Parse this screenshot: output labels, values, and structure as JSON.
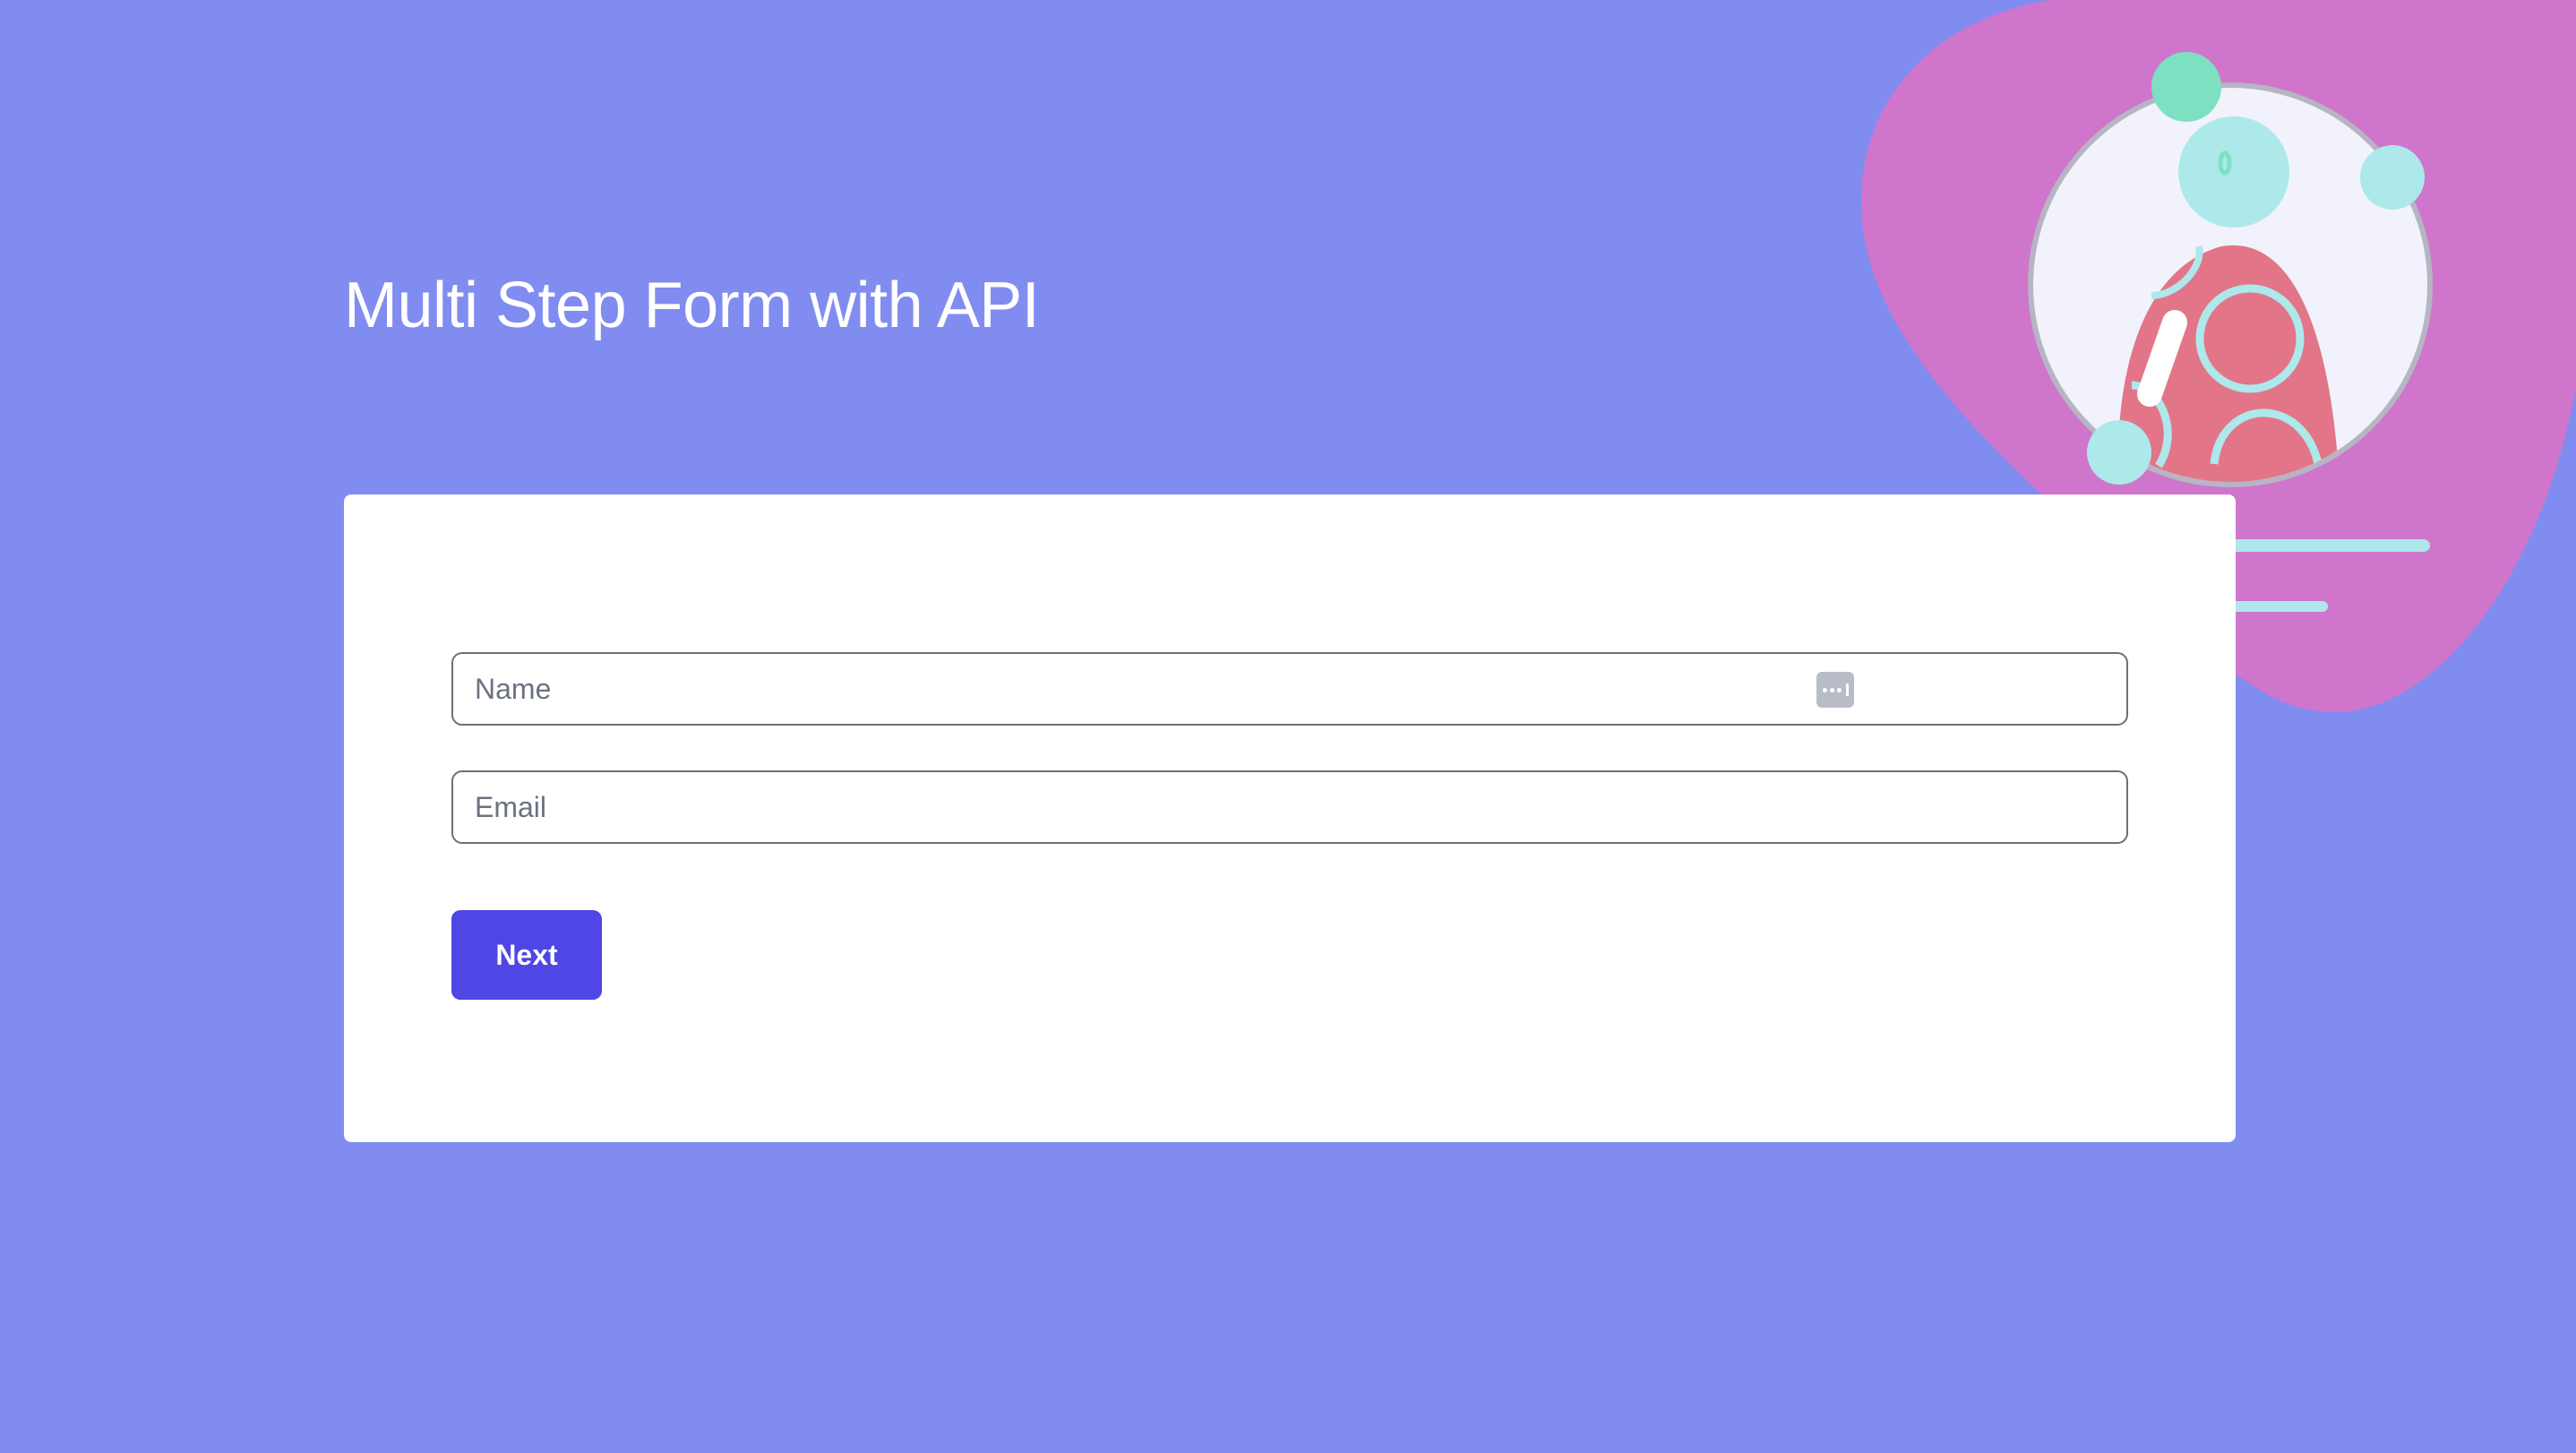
{
  "page": {
    "title": "Multi Step Form with API"
  },
  "form": {
    "name_placeholder": "Name",
    "email_placeholder": "Email",
    "next_label": "Next"
  },
  "colors": {
    "background": "#818cf0",
    "card": "#ffffff",
    "accent": "#4f46e5",
    "blob": "#d374c9",
    "figure": "#e37588",
    "dot_cyan": "#ade8ea",
    "dot_green": "#7ee0c3"
  },
  "icons": {
    "autofill": "password-manager-key-icon",
    "illustration": "profile-avatar-illustration"
  }
}
